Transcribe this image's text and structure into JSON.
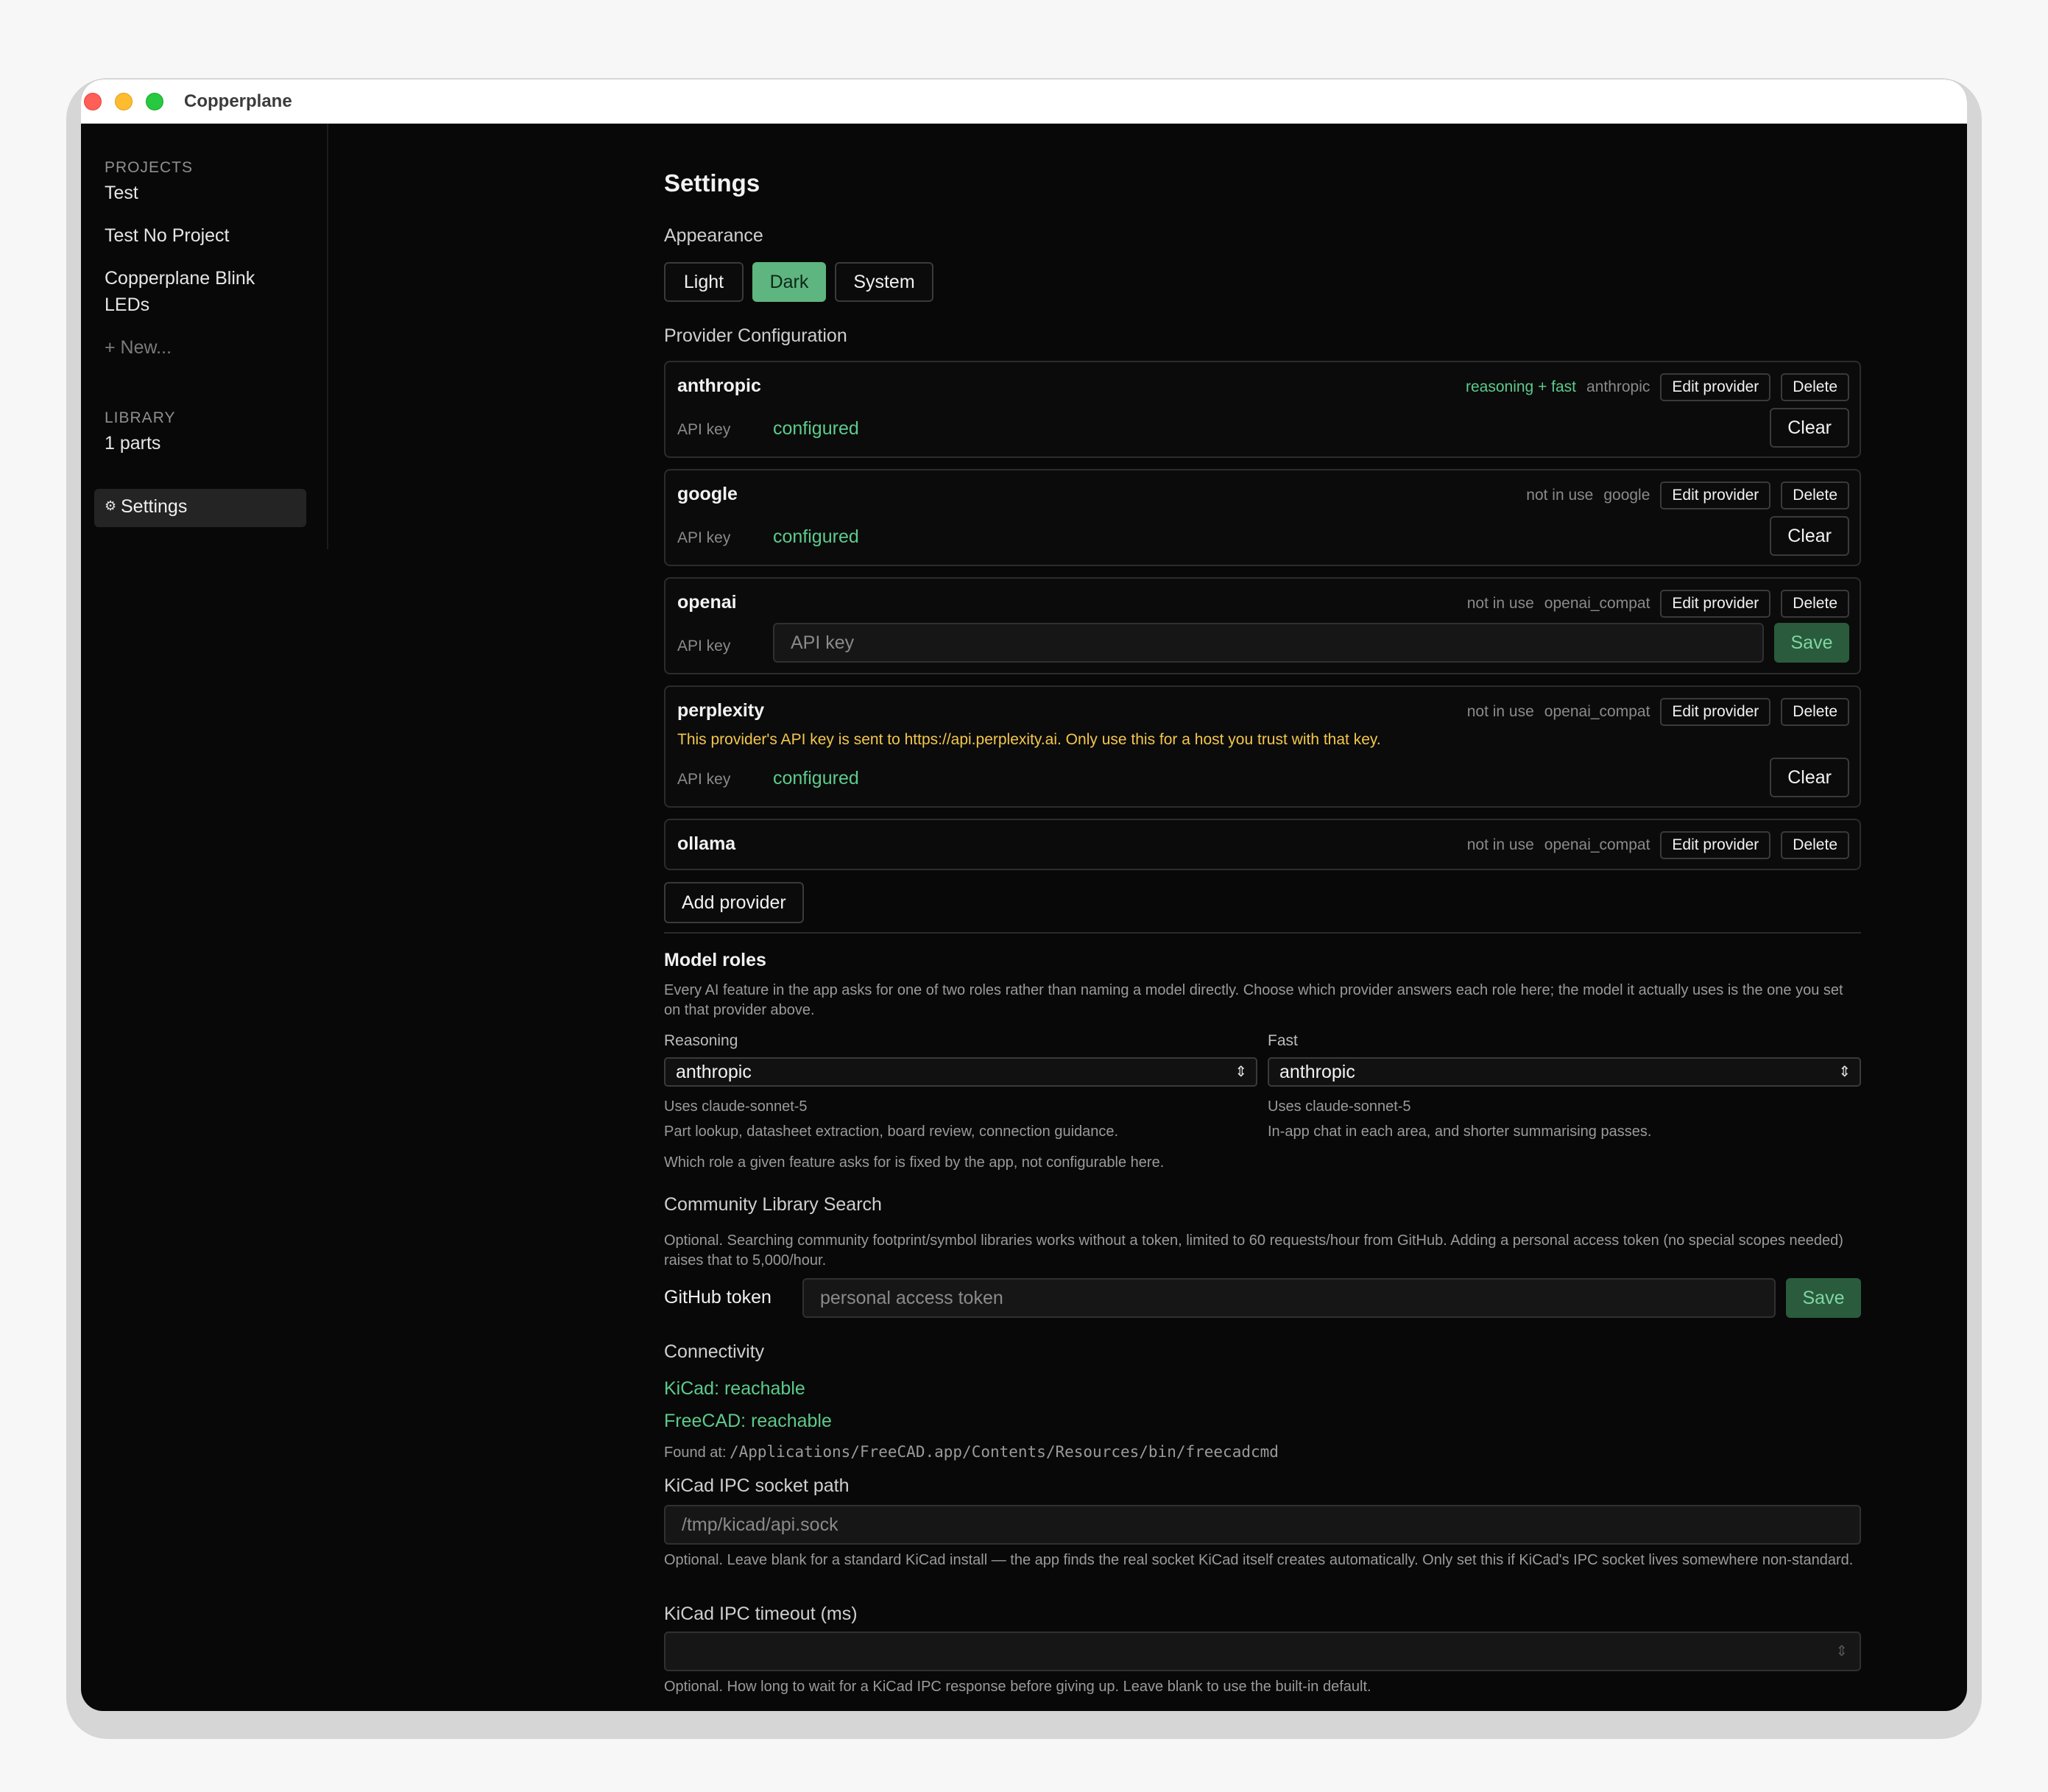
{
  "window": {
    "title": "Copperplane"
  },
  "sidebar": {
    "projects_header": "PROJECTS",
    "projects": [
      "Test",
      "Test No Project",
      "Copperplane Blink LEDs"
    ],
    "new_label": "+ New...",
    "library_header": "LIBRARY",
    "library_parts": "1 parts",
    "settings_icon": "⚙",
    "settings_label": "Settings"
  },
  "settings": {
    "title": "Settings",
    "appearance": {
      "label": "Appearance",
      "options": [
        "Light",
        "Dark",
        "System"
      ],
      "selected": "Dark"
    },
    "provider_config": {
      "label": "Provider Configuration",
      "edit_label": "Edit provider",
      "delete_label": "Delete",
      "api_key_label": "API key",
      "clear_label": "Clear",
      "save_label": "Save",
      "providers": [
        {
          "name": "anthropic",
          "status": "reasoning + fast",
          "type": "anthropic",
          "key_state": "configured"
        },
        {
          "name": "google",
          "status": "not in use",
          "type": "google",
          "key_state": "configured"
        },
        {
          "name": "openai",
          "status": "not in use",
          "type": "openai_compat",
          "key_placeholder": "API key"
        },
        {
          "name": "perplexity",
          "status": "not in use",
          "type": "openai_compat",
          "warning": "This provider's API key is sent to https://api.perplexity.ai. Only use this for a host you trust with that key.",
          "key_state": "configured"
        },
        {
          "name": "ollama",
          "status": "not in use",
          "type": "openai_compat"
        }
      ],
      "add_label": "Add provider"
    },
    "model_roles": {
      "title": "Model roles",
      "description": "Every AI feature in the app asks for one of two roles rather than naming a model directly. Choose which provider answers each role here; the model it actually uses is the one you set on that provider above.",
      "reasoning": {
        "label": "Reasoning",
        "selected": "anthropic",
        "uses": "Uses claude-sonnet-5",
        "purpose": "Part lookup, datasheet extraction, board review, connection guidance."
      },
      "fast": {
        "label": "Fast",
        "selected": "anthropic",
        "uses": "Uses claude-sonnet-5",
        "purpose": "In-app chat in each area, and shorter summarising passes."
      },
      "note": "Which role a given feature asks for is fixed by the app, not configurable here."
    },
    "community": {
      "title": "Community Library Search",
      "description": "Optional. Searching community footprint/symbol libraries works without a token, limited to 60 requests/hour from GitHub. Adding a personal access token (no special scopes needed) raises that to 5,000/hour.",
      "token_label": "GitHub token",
      "token_placeholder": "personal access token",
      "save_label": "Save"
    },
    "connectivity": {
      "title": "Connectivity",
      "kicad_status": "KiCad: reachable",
      "freecad_status": "FreeCAD: reachable",
      "found_prefix": "Found at:",
      "found_path": "/Applications/FreeCAD.app/Contents/Resources/bin/freecadcmd",
      "socket_label": "KiCad IPC socket path",
      "socket_placeholder": "/tmp/kicad/api.sock",
      "socket_help": "Optional. Leave blank for a standard KiCad install — the app finds the real socket KiCad itself creates automatically. Only set this if KiCad's IPC socket lives somewhere non-standard.",
      "timeout_label": "KiCad IPC timeout (ms)",
      "timeout_help": "Optional. How long to wait for a KiCad IPC response before giving up. Leave blank to use the built-in default."
    },
    "colors": {
      "accent": "#5fb57f",
      "status_ok": "#5ccb8b",
      "warning": "#f3c74c"
    }
  }
}
